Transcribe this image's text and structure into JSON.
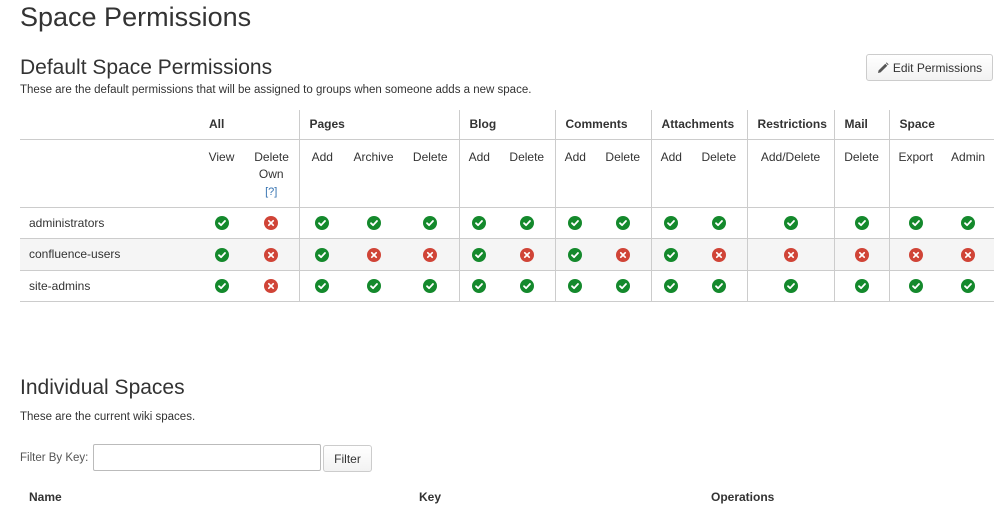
{
  "page": {
    "title": "Space Permissions"
  },
  "default_section": {
    "title": "Default Space Permissions",
    "description": "These are the default permissions that will be assigned to groups when someone adds a new space.",
    "edit_button": "Edit Permissions",
    "categories": [
      "All",
      "Pages",
      "Blog",
      "Comments",
      "Attachments",
      "Restrictions",
      "Mail",
      "Space"
    ],
    "subheaders": {
      "all_view": "View",
      "all_delete_own": "Delete Own",
      "help_link": "[?]",
      "pages_add": "Add",
      "pages_archive": "Archive",
      "pages_delete": "Delete",
      "blog_add": "Add",
      "blog_delete": "Delete",
      "comments_add": "Add",
      "comments_delete": "Delete",
      "attachments_add": "Add",
      "attachments_delete": "Delete",
      "restrictions_adddelete": "Add/Delete",
      "mail_delete": "Delete",
      "space_export": "Export",
      "space_admin": "Admin"
    },
    "groups": [
      {
        "name": "administrators",
        "perms": [
          true,
          false,
          true,
          true,
          true,
          true,
          true,
          true,
          true,
          true,
          true,
          true,
          true,
          true,
          true
        ]
      },
      {
        "name": "confluence-users",
        "perms": [
          true,
          false,
          true,
          false,
          false,
          true,
          false,
          true,
          false,
          true,
          false,
          false,
          false,
          false,
          false
        ]
      },
      {
        "name": "site-admins",
        "perms": [
          true,
          false,
          true,
          true,
          true,
          true,
          true,
          true,
          true,
          true,
          true,
          true,
          true,
          true,
          true
        ]
      }
    ],
    "colors": {
      "granted": "#14892c",
      "denied": "#d04437"
    }
  },
  "individual_section": {
    "title": "Individual Spaces",
    "description": "These are the current wiki spaces.",
    "filter_label": "Filter By Key:",
    "filter_value": "",
    "filter_button": "Filter",
    "columns": {
      "name": "Name",
      "key": "Key",
      "operations": "Operations"
    }
  }
}
